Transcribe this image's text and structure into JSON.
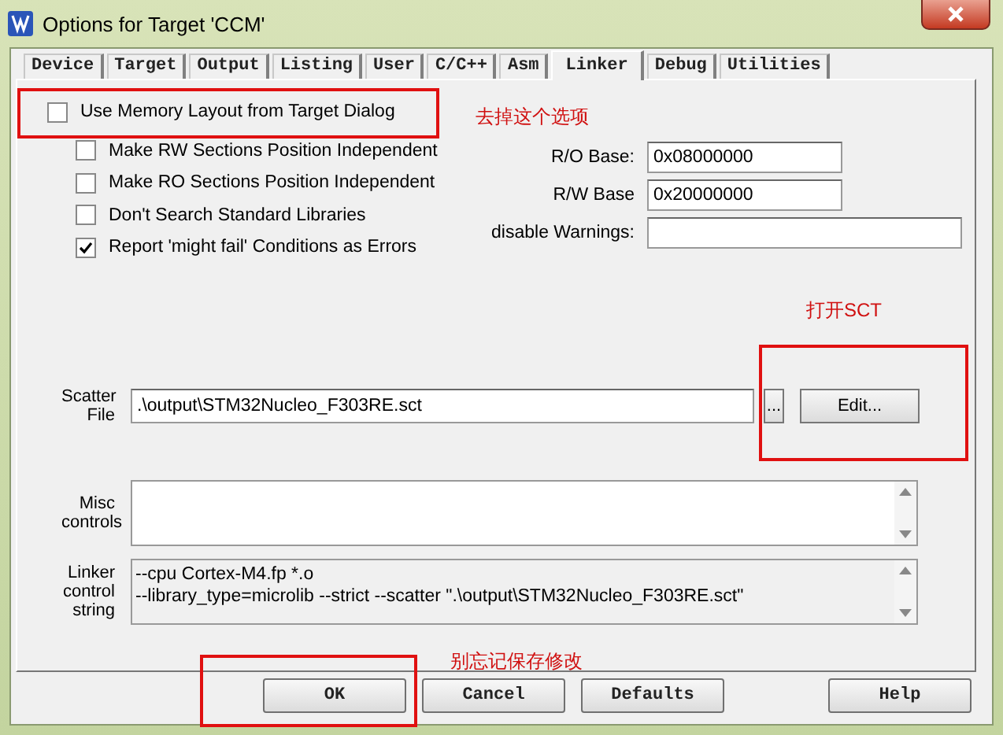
{
  "window": {
    "title": "Options for Target 'CCM'"
  },
  "tabs": [
    {
      "label": "Device",
      "selected": false
    },
    {
      "label": "Target",
      "selected": false
    },
    {
      "label": "Output",
      "selected": false
    },
    {
      "label": "Listing",
      "selected": false
    },
    {
      "label": "User",
      "selected": false
    },
    {
      "label": "C/C++",
      "selected": false
    },
    {
      "label": "Asm",
      "selected": false
    },
    {
      "label": "Linker",
      "selected": true
    },
    {
      "label": "Debug",
      "selected": false
    },
    {
      "label": "Utilities",
      "selected": false
    }
  ],
  "options": [
    {
      "label": "Use Memory Layout from Target Dialog",
      "checked": false,
      "kind": "main"
    },
    {
      "label": "Make RW Sections Position Independent",
      "checked": false,
      "kind": "sub"
    },
    {
      "label": "Make RO Sections Position Independent",
      "checked": false,
      "kind": "sub"
    },
    {
      "label": "Don't Search Standard Libraries",
      "checked": false,
      "kind": "sub"
    },
    {
      "label": "Report 'might fail' Conditions as Errors",
      "checked": true,
      "kind": "sub"
    }
  ],
  "fields": [
    {
      "label": "R/O Base:",
      "value": "0x08000000",
      "kind": "short"
    },
    {
      "label": "R/W Base",
      "value": "0x20000000",
      "kind": "short"
    },
    {
      "label": "disable Warnings:",
      "kind": "wide"
    }
  ],
  "scatter_file": {
    "label": "Scatter File",
    "value": ".\\output\\STM32Nucleo_F303RE.sct",
    "browse": "...",
    "edit": "Edit..."
  },
  "misc_controls": {
    "label": "Misc controls"
  },
  "linker_control_string": {
    "label": "Linker control string",
    "lines": [
      "--cpu Cortex-M4.fp *.o",
      "--library_type=microlib --strict --scatter \".\\output\\STM32Nucleo_F303RE.sct\""
    ]
  },
  "buttons": [
    {
      "label": "OK"
    },
    {
      "label": "Cancel"
    },
    {
      "label": "Defaults"
    },
    {
      "label": "Help"
    }
  ],
  "annotations": [
    {
      "text": "去掉这个选项"
    },
    {
      "text": "打开SCT"
    },
    {
      "text": "别忘记保存修改"
    }
  ]
}
